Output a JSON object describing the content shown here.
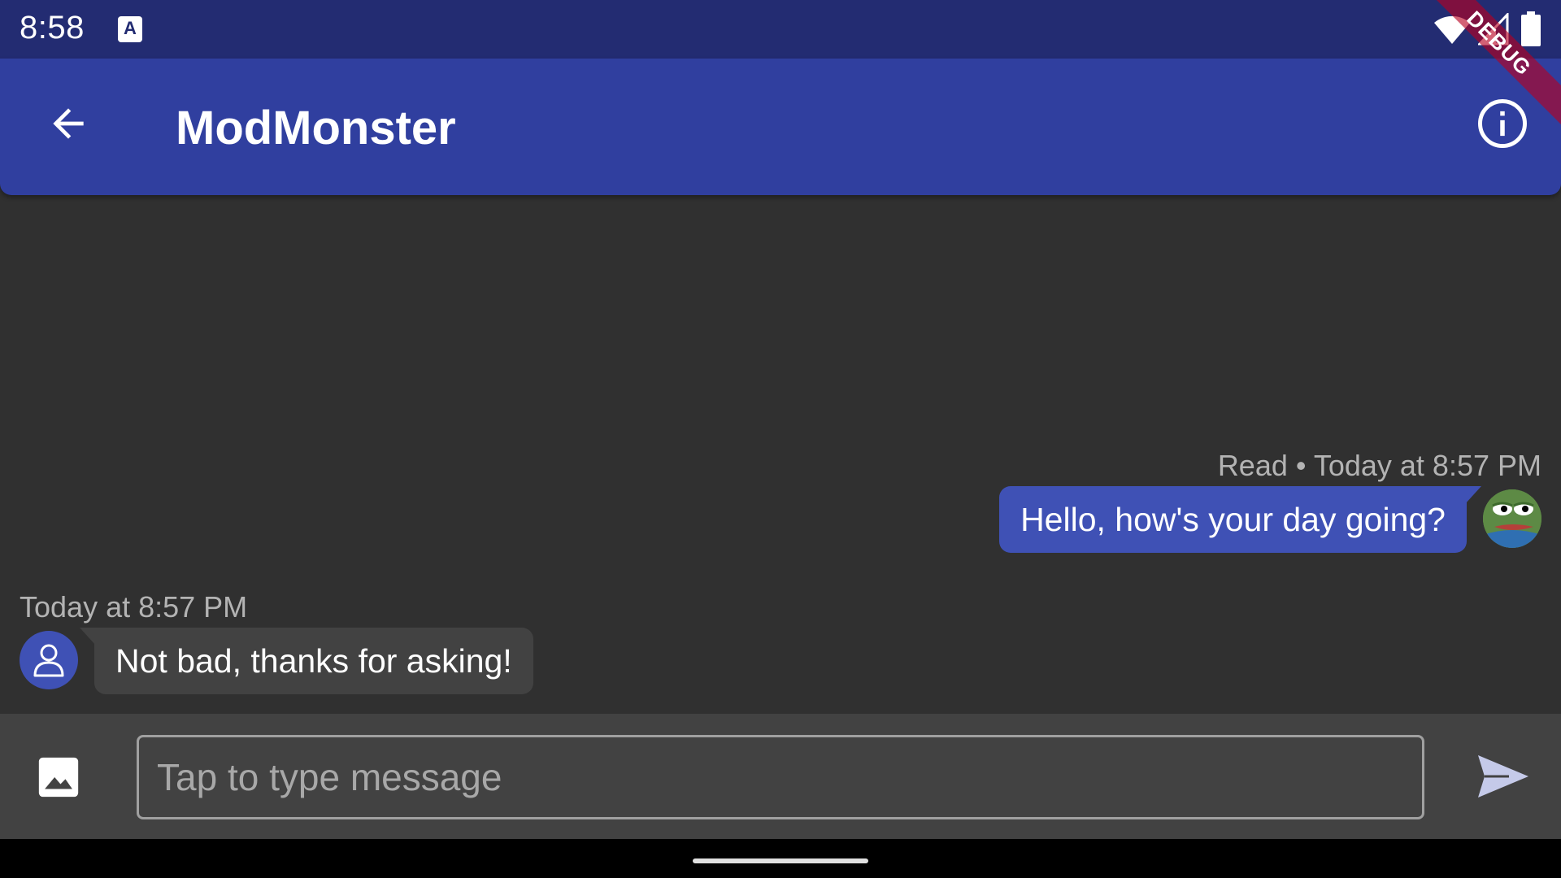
{
  "status_bar": {
    "time": "8:58",
    "notification_icon": "a-accessibility-icon",
    "icons": [
      "wifi-icon",
      "signal-icon",
      "battery-icon"
    ]
  },
  "debug_banner": "DEBUG",
  "app_bar": {
    "title": "ModMonster",
    "back_icon": "arrow-back-icon",
    "info_icon": "info-icon"
  },
  "messages": [
    {
      "direction": "sent",
      "meta": "Read • Today at 8:57 PM",
      "text": "Hello, how's your day going?",
      "avatar": "frog-avatar"
    },
    {
      "direction": "received",
      "meta": "Today at 8:57 PM",
      "text": "Not bad, thanks for asking!",
      "avatar": "default-person-avatar"
    }
  ],
  "composer": {
    "placeholder": "Tap to type message",
    "value": "",
    "image_icon": "image-icon",
    "send_icon": "send-icon"
  },
  "colors": {
    "status_bar": "#232c72",
    "app_bar": "#303f9f",
    "background": "#303030",
    "sent_bubble": "#3f51b5",
    "received_bubble": "#424242",
    "composer": "#424242",
    "meta_text": "#b3b3b3",
    "debug_ribbon": "#b80020"
  }
}
